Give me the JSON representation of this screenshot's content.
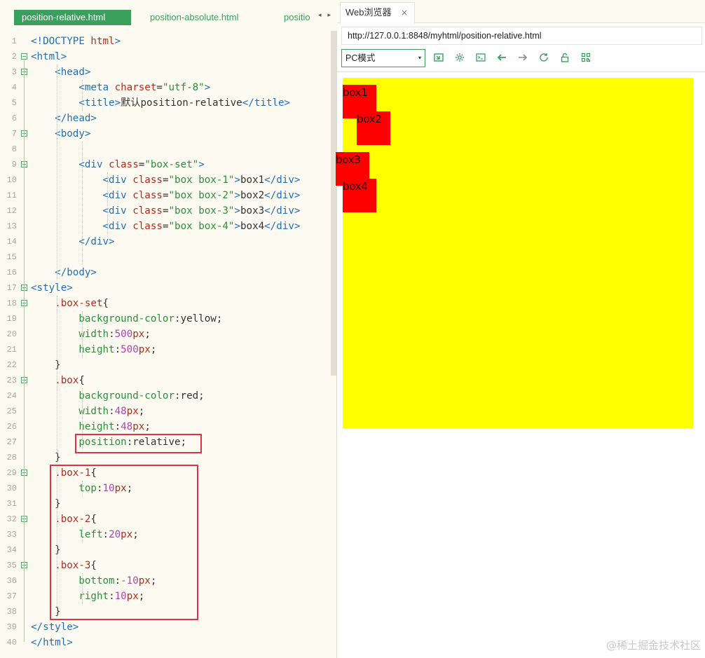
{
  "editor": {
    "tabs": [
      {
        "label": "position-relative.html"
      },
      {
        "label": "position-absolute.html"
      },
      {
        "label": "positio"
      }
    ],
    "tab_scroll": "◂ ▸",
    "lines": [
      {
        "n": "1",
        "seg": [
          [
            "t-tag",
            "<!DOCTYPE "
          ],
          [
            "t-attr",
            "html"
          ],
          [
            "t-tag",
            ">"
          ]
        ]
      },
      {
        "n": "2",
        "seg": [
          [
            "t-tag",
            "<html>"
          ]
        ]
      },
      {
        "n": "3",
        "seg": [
          [
            "t-pl",
            "    "
          ],
          [
            "t-tag",
            "<head>"
          ]
        ]
      },
      {
        "n": "4",
        "seg": [
          [
            "t-pl",
            "        "
          ],
          [
            "t-tag",
            "<meta "
          ],
          [
            "t-attr",
            "charset"
          ],
          [
            "t-pl",
            "="
          ],
          [
            "t-str",
            "\"utf-8\""
          ],
          [
            "t-tag",
            ">"
          ]
        ]
      },
      {
        "n": "5",
        "seg": [
          [
            "t-pl",
            "        "
          ],
          [
            "t-tag",
            "<title>"
          ],
          [
            "t-text",
            "默认position-relative"
          ],
          [
            "t-tag",
            "</title>"
          ]
        ]
      },
      {
        "n": "6",
        "seg": [
          [
            "t-pl",
            "    "
          ],
          [
            "t-tag",
            "</head>"
          ]
        ]
      },
      {
        "n": "7",
        "seg": [
          [
            "t-pl",
            "    "
          ],
          [
            "t-tag",
            "<body>"
          ]
        ]
      },
      {
        "n": "8",
        "seg": []
      },
      {
        "n": "9",
        "seg": [
          [
            "t-pl",
            "        "
          ],
          [
            "t-tag",
            "<div "
          ],
          [
            "t-attr",
            "class"
          ],
          [
            "t-pl",
            "="
          ],
          [
            "t-str",
            "\"box-set\""
          ],
          [
            "t-tag",
            ">"
          ]
        ]
      },
      {
        "n": "10",
        "seg": [
          [
            "t-pl",
            "            "
          ],
          [
            "t-tag",
            "<div "
          ],
          [
            "t-attr",
            "class"
          ],
          [
            "t-pl",
            "="
          ],
          [
            "t-str",
            "\"box box-1\""
          ],
          [
            "t-tag",
            ">"
          ],
          [
            "t-text",
            "box1"
          ],
          [
            "t-tag",
            "</div>"
          ]
        ]
      },
      {
        "n": "11",
        "seg": [
          [
            "t-pl",
            "            "
          ],
          [
            "t-tag",
            "<div "
          ],
          [
            "t-attr",
            "class"
          ],
          [
            "t-pl",
            "="
          ],
          [
            "t-str",
            "\"box box-2\""
          ],
          [
            "t-tag",
            ">"
          ],
          [
            "t-text",
            "box2"
          ],
          [
            "t-tag",
            "</div>"
          ]
        ]
      },
      {
        "n": "12",
        "seg": [
          [
            "t-pl",
            "            "
          ],
          [
            "t-tag",
            "<div "
          ],
          [
            "t-attr",
            "class"
          ],
          [
            "t-pl",
            "="
          ],
          [
            "t-str",
            "\"box box-3\""
          ],
          [
            "t-tag",
            ">"
          ],
          [
            "t-text",
            "box3"
          ],
          [
            "t-tag",
            "</div>"
          ]
        ]
      },
      {
        "n": "13",
        "seg": [
          [
            "t-pl",
            "            "
          ],
          [
            "t-tag",
            "<div "
          ],
          [
            "t-attr",
            "class"
          ],
          [
            "t-pl",
            "="
          ],
          [
            "t-str",
            "\"box box-4\""
          ],
          [
            "t-tag",
            ">"
          ],
          [
            "t-text",
            "box4"
          ],
          [
            "t-tag",
            "</div>"
          ]
        ]
      },
      {
        "n": "14",
        "seg": [
          [
            "t-pl",
            "        "
          ],
          [
            "t-tag",
            "</div>"
          ]
        ]
      },
      {
        "n": "15",
        "seg": []
      },
      {
        "n": "16",
        "seg": [
          [
            "t-pl",
            "    "
          ],
          [
            "t-tag",
            "</body>"
          ]
        ]
      },
      {
        "n": "17",
        "seg": [
          [
            "t-tag",
            "<style>"
          ]
        ]
      },
      {
        "n": "18",
        "seg": [
          [
            "t-pl",
            "    "
          ],
          [
            "t-sel",
            ".box-set"
          ],
          [
            "t-pl",
            "{"
          ]
        ]
      },
      {
        "n": "19",
        "seg": [
          [
            "t-pl",
            "        "
          ],
          [
            "t-prop",
            "background-color"
          ],
          [
            "t-pl",
            ":yellow;"
          ]
        ]
      },
      {
        "n": "20",
        "seg": [
          [
            "t-pl",
            "        "
          ],
          [
            "t-prop",
            "width"
          ],
          [
            "t-pl",
            ":"
          ],
          [
            "t-val",
            "500"
          ],
          [
            "t-unit",
            "px"
          ],
          [
            "t-pl",
            ";"
          ]
        ]
      },
      {
        "n": "21",
        "seg": [
          [
            "t-pl",
            "        "
          ],
          [
            "t-prop",
            "height"
          ],
          [
            "t-pl",
            ":"
          ],
          [
            "t-val",
            "500"
          ],
          [
            "t-unit",
            "px"
          ],
          [
            "t-pl",
            ";"
          ]
        ]
      },
      {
        "n": "22",
        "seg": [
          [
            "t-pl",
            "    }"
          ]
        ]
      },
      {
        "n": "23",
        "seg": [
          [
            "t-pl",
            "    "
          ],
          [
            "t-sel",
            ".box"
          ],
          [
            "t-pl",
            "{"
          ]
        ]
      },
      {
        "n": "24",
        "seg": [
          [
            "t-pl",
            "        "
          ],
          [
            "t-prop",
            "background-color"
          ],
          [
            "t-pl",
            ":red;"
          ]
        ]
      },
      {
        "n": "25",
        "seg": [
          [
            "t-pl",
            "        "
          ],
          [
            "t-prop",
            "width"
          ],
          [
            "t-pl",
            ":"
          ],
          [
            "t-val",
            "48"
          ],
          [
            "t-unit",
            "px"
          ],
          [
            "t-pl",
            ";"
          ]
        ]
      },
      {
        "n": "26",
        "seg": [
          [
            "t-pl",
            "        "
          ],
          [
            "t-prop",
            "height"
          ],
          [
            "t-pl",
            ":"
          ],
          [
            "t-val",
            "48"
          ],
          [
            "t-unit",
            "px"
          ],
          [
            "t-pl",
            ";"
          ]
        ]
      },
      {
        "n": "27",
        "seg": [
          [
            "t-pl",
            "        "
          ],
          [
            "t-prop",
            "position"
          ],
          [
            "t-pl",
            ":relative;"
          ]
        ]
      },
      {
        "n": "28",
        "seg": [
          [
            "t-pl",
            "    }"
          ]
        ]
      },
      {
        "n": "29",
        "seg": [
          [
            "t-pl",
            "    "
          ],
          [
            "t-sel",
            ".box-1"
          ],
          [
            "t-pl",
            "{"
          ]
        ]
      },
      {
        "n": "30",
        "seg": [
          [
            "t-pl",
            "        "
          ],
          [
            "t-prop",
            "top"
          ],
          [
            "t-pl",
            ":"
          ],
          [
            "t-val",
            "10"
          ],
          [
            "t-unit",
            "px"
          ],
          [
            "t-pl",
            ";"
          ]
        ]
      },
      {
        "n": "31",
        "seg": [
          [
            "t-pl",
            "    }"
          ]
        ]
      },
      {
        "n": "32",
        "seg": [
          [
            "t-pl",
            "    "
          ],
          [
            "t-sel",
            ".box-2"
          ],
          [
            "t-pl",
            "{"
          ]
        ]
      },
      {
        "n": "33",
        "seg": [
          [
            "t-pl",
            "        "
          ],
          [
            "t-prop",
            "left"
          ],
          [
            "t-pl",
            ":"
          ],
          [
            "t-val",
            "20"
          ],
          [
            "t-unit",
            "px"
          ],
          [
            "t-pl",
            ";"
          ]
        ]
      },
      {
        "n": "34",
        "seg": [
          [
            "t-pl",
            "    }"
          ]
        ]
      },
      {
        "n": "35",
        "seg": [
          [
            "t-pl",
            "    "
          ],
          [
            "t-sel",
            ".box-3"
          ],
          [
            "t-pl",
            "{"
          ]
        ]
      },
      {
        "n": "36",
        "seg": [
          [
            "t-pl",
            "        "
          ],
          [
            "t-prop",
            "bottom"
          ],
          [
            "t-pl",
            ":"
          ],
          [
            "t-val",
            "-10"
          ],
          [
            "t-unit",
            "px"
          ],
          [
            "t-pl",
            ";"
          ]
        ]
      },
      {
        "n": "37",
        "seg": [
          [
            "t-pl",
            "        "
          ],
          [
            "t-prop",
            "right"
          ],
          [
            "t-pl",
            ":"
          ],
          [
            "t-val",
            "10"
          ],
          [
            "t-unit",
            "px"
          ],
          [
            "t-pl",
            ";"
          ]
        ]
      },
      {
        "n": "38",
        "seg": [
          [
            "t-pl",
            "    }"
          ]
        ]
      },
      {
        "n": "39",
        "seg": [
          [
            "t-tag",
            "</style>"
          ]
        ]
      },
      {
        "n": "40",
        "seg": [
          [
            "t-tag",
            "</html>"
          ]
        ]
      }
    ]
  },
  "browser": {
    "tab_label": "Web浏览器",
    "tab_close": "×",
    "url": "http://127.0.0.1:8848/myhtml/position-relative.html",
    "mode": "PC模式",
    "mode_caret": "▾",
    "toolbar_icons": [
      "screenshot-icon",
      "settings-icon",
      "console-icon",
      "back-arrow-icon",
      "forward-arrow-icon",
      "reload-icon",
      "lock-icon",
      "qrcode-icon"
    ],
    "boxes": [
      {
        "id": "box1",
        "label": "box1"
      },
      {
        "id": "box2",
        "label": "box2"
      },
      {
        "id": "box3",
        "label": "box3"
      },
      {
        "id": "box4",
        "label": "box4"
      }
    ],
    "colors": {
      "box_set": "#ffff00",
      "box": "#ff0000",
      "accent": "#39a15c",
      "highlight": "#d9363e"
    }
  },
  "watermark": "@稀土掘金技术社区"
}
